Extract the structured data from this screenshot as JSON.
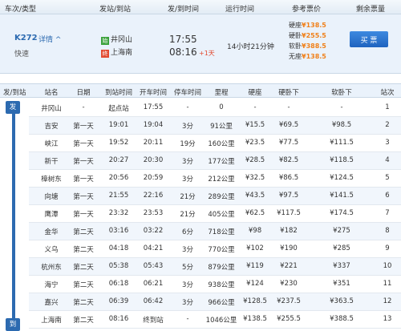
{
  "header": {
    "train_type": "车次/类型",
    "from_to": "发站/到站",
    "times": "发/到时间",
    "duration": "运行时间",
    "ref_price": "参考票价",
    "remaining": "剩余票量"
  },
  "train": {
    "number": "K272",
    "detail_link": "详情 ^",
    "type": "快速",
    "from_station": "井冈山",
    "to_station": "上海南",
    "from_marker": "始",
    "to_marker": "终",
    "depart_time": "17:55",
    "arrive_time": "08:16",
    "plus_day": "+1天",
    "duration": "14小时21分钟",
    "prices": [
      {
        "label": "硬座",
        "value": "¥138.5"
      },
      {
        "label": "硬卧",
        "value": "¥255.5"
      },
      {
        "label": "软卧",
        "value": "¥388.5"
      },
      {
        "label": "无座",
        "value": "¥138.5"
      }
    ],
    "buy_label": "买 票"
  },
  "stops_table": {
    "headers": [
      "发/到站",
      "站名",
      "日期",
      "到站时间",
      "开车时间",
      "停车时间",
      "里程",
      "硬座",
      "硬卧下",
      "软卧下",
      "站次"
    ],
    "rail_start": "发",
    "rail_end": "到",
    "rows": [
      [
        "井冈山",
        "-",
        "起点站",
        "17:55",
        "-",
        "0",
        "-",
        "-",
        "-",
        "1"
      ],
      [
        "吉安",
        "第一天",
        "19:01",
        "19:04",
        "3分",
        "91公里",
        "¥15.5",
        "¥69.5",
        "¥98.5",
        "2"
      ],
      [
        "峡江",
        "第一天",
        "19:52",
        "20:11",
        "19分",
        "160公里",
        "¥23.5",
        "¥77.5",
        "¥111.5",
        "3"
      ],
      [
        "新干",
        "第一天",
        "20:27",
        "20:30",
        "3分",
        "177公里",
        "¥28.5",
        "¥82.5",
        "¥118.5",
        "4"
      ],
      [
        "樟树东",
        "第一天",
        "20:56",
        "20:59",
        "3分",
        "212公里",
        "¥32.5",
        "¥86.5",
        "¥124.5",
        "5"
      ],
      [
        "向塘",
        "第一天",
        "21:55",
        "22:16",
        "21分",
        "289公里",
        "¥43.5",
        "¥97.5",
        "¥141.5",
        "6"
      ],
      [
        "鹰潭",
        "第一天",
        "23:32",
        "23:53",
        "21分",
        "405公里",
        "¥62.5",
        "¥117.5",
        "¥174.5",
        "7"
      ],
      [
        "金华",
        "第二天",
        "03:16",
        "03:22",
        "6分",
        "718公里",
        "¥98",
        "¥182",
        "¥275",
        "8"
      ],
      [
        "义乌",
        "第二天",
        "04:18",
        "04:21",
        "3分",
        "770公里",
        "¥102",
        "¥190",
        "¥285",
        "9"
      ],
      [
        "杭州东",
        "第二天",
        "05:38",
        "05:43",
        "5分",
        "879公里",
        "¥119",
        "¥221",
        "¥337",
        "10"
      ],
      [
        "海宁",
        "第二天",
        "06:18",
        "06:21",
        "3分",
        "938公里",
        "¥124",
        "¥230",
        "¥351",
        "11"
      ],
      [
        "嘉兴",
        "第二天",
        "06:39",
        "06:42",
        "3分",
        "966公里",
        "¥128.5",
        "¥237.5",
        "¥363.5",
        "12"
      ],
      [
        "上海南",
        "第二天",
        "08:16",
        "终到站",
        "-",
        "1046公里",
        "¥138.5",
        "¥255.5",
        "¥388.5",
        "13"
      ]
    ]
  },
  "colors": {
    "accent": "#2c6ab0",
    "price": "#f08019",
    "start_marker": "#3aa13a",
    "end_marker": "#e24a30"
  }
}
